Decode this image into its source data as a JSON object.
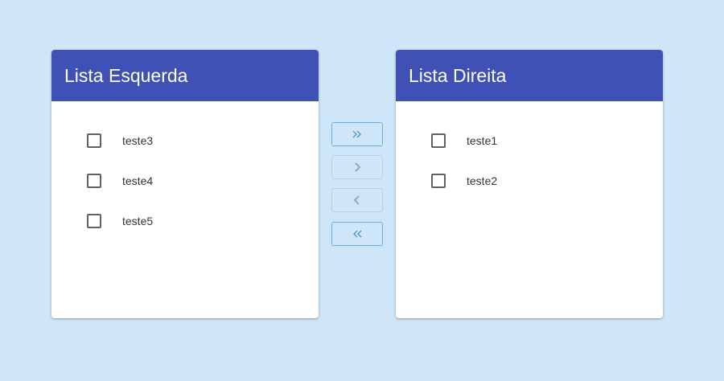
{
  "left_list": {
    "title": "Lista Esquerda",
    "items": [
      {
        "label": "teste3",
        "checked": false
      },
      {
        "label": "teste4",
        "checked": false
      },
      {
        "label": "teste5",
        "checked": false
      }
    ]
  },
  "right_list": {
    "title": "Lista Direita",
    "items": [
      {
        "label": "teste1",
        "checked": false
      },
      {
        "label": "teste2",
        "checked": false
      }
    ]
  },
  "transfer_buttons": [
    {
      "icon": "double-chevron-right-icon",
      "enabled": true
    },
    {
      "icon": "chevron-right-icon",
      "enabled": false
    },
    {
      "icon": "chevron-left-icon",
      "enabled": false
    },
    {
      "icon": "double-chevron-left-icon",
      "enabled": true
    }
  ],
  "colors": {
    "background": "#cfe6f9",
    "header": "#3f51b5",
    "button_border": "#6aaee0"
  }
}
